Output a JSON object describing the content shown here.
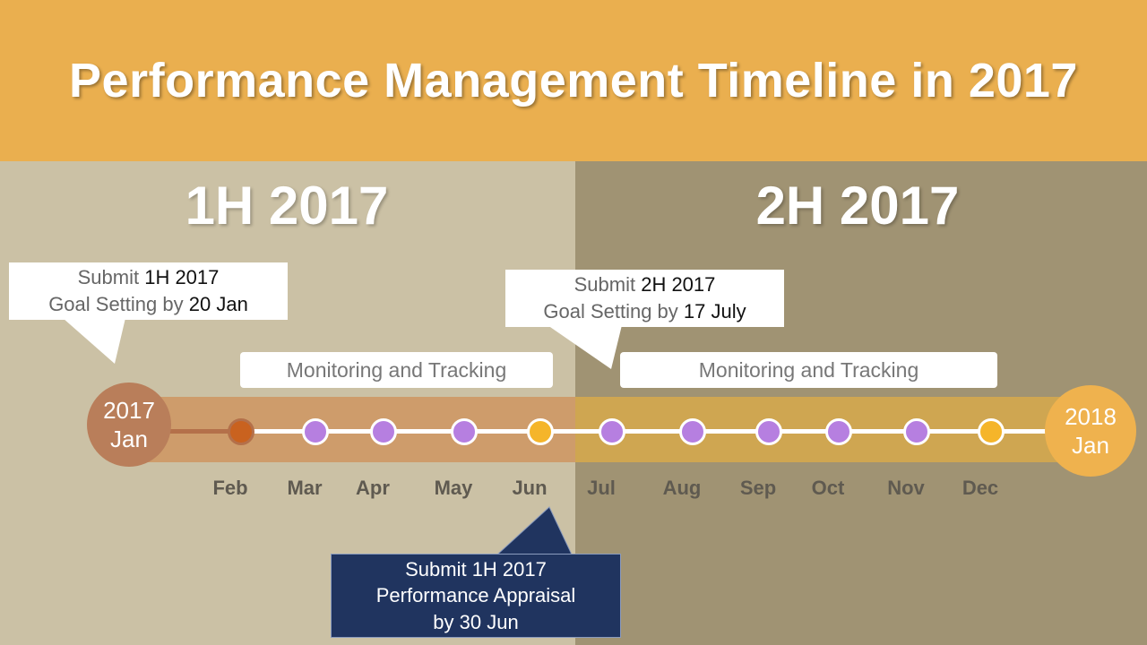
{
  "title": "Performance Management Timeline in 2017",
  "halves": {
    "first": "1H 2017",
    "second": "2H 2017"
  },
  "endpoints": {
    "start": {
      "year": "2017",
      "month": "Jan"
    },
    "end": {
      "year": "2018",
      "month": "Jan"
    }
  },
  "months": [
    {
      "label": "Feb",
      "status": "completed"
    },
    {
      "label": "Mar",
      "status": "regular"
    },
    {
      "label": "Apr",
      "status": "regular"
    },
    {
      "label": "May",
      "status": "regular"
    },
    {
      "label": "Jun",
      "status": "milestone"
    },
    {
      "label": "Jul",
      "status": "regular"
    },
    {
      "label": "Aug",
      "status": "regular"
    },
    {
      "label": "Sep",
      "status": "regular"
    },
    {
      "label": "Oct",
      "status": "regular"
    },
    {
      "label": "Nov",
      "status": "regular"
    },
    {
      "label": "Dec",
      "status": "milestone"
    }
  ],
  "callouts": {
    "goal_1h": {
      "line1_prefix": "Submit",
      "line1_emph": "1H 2017",
      "line2_prefix": "Goal Setting by",
      "line2_emph": "20 Jan"
    },
    "goal_2h": {
      "line1_prefix": "Submit",
      "line1_emph": "2H 2017",
      "line2_prefix": "Goal Setting by",
      "line2_emph": "17 July"
    },
    "appraisal_1h": {
      "line1": "Submit 1H 2017",
      "line2": "Performance Appraisal",
      "line3": "by 30 Jun"
    }
  },
  "phases": {
    "first": "Monitoring and Tracking",
    "second": "Monitoring and Tracking"
  },
  "colors": {
    "title_bar": "#EAAF4F",
    "half1_bg": "#CBC1A5",
    "half2_bg": "#A09373",
    "regular_dot": "#B67FE0",
    "milestone_dot": "#F5B52A",
    "completed_dot": "#C9621F",
    "appraisal_box": "#20345F"
  }
}
